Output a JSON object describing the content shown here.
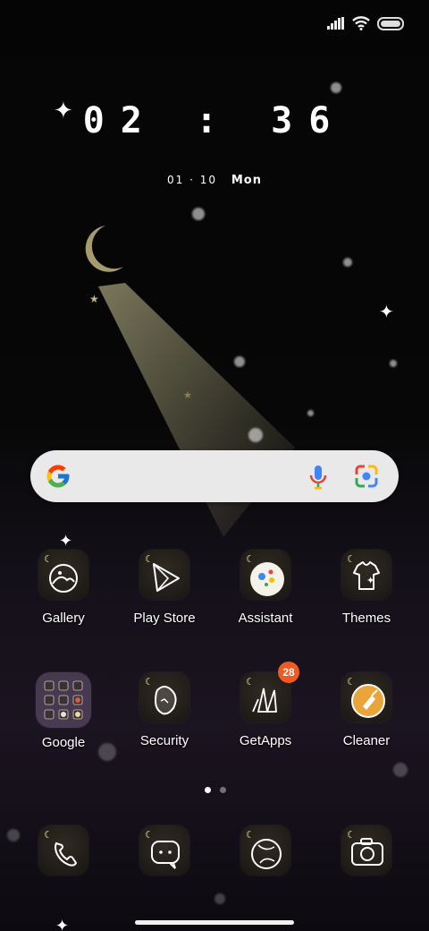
{
  "status_bar": {
    "signal_icon": "signal-bars-icon",
    "wifi_icon": "wifi-icon",
    "battery_icon": "battery-icon"
  },
  "clock": {
    "time": "02 : 36",
    "date": "01 · 10",
    "day": "Mon"
  },
  "search_bar": {
    "logo_icon": "google-g-icon",
    "mic_icon": "microphone-icon",
    "lens_icon": "google-lens-icon"
  },
  "apps": {
    "row1": [
      {
        "label": "Gallery",
        "icon": "gallery-icon"
      },
      {
        "label": "Play Store",
        "icon": "play-store-icon"
      },
      {
        "label": "Assistant",
        "icon": "assistant-icon"
      },
      {
        "label": "Themes",
        "icon": "themes-icon"
      }
    ],
    "row2": [
      {
        "label": "Google",
        "icon": "google-folder-icon"
      },
      {
        "label": "Security",
        "icon": "security-icon"
      },
      {
        "label": "GetApps",
        "icon": "getapps-icon",
        "badge": "28"
      },
      {
        "label": "Cleaner",
        "icon": "cleaner-icon"
      }
    ]
  },
  "dock": [
    {
      "icon": "phone-icon"
    },
    {
      "icon": "messages-icon"
    },
    {
      "icon": "browser-icon"
    },
    {
      "icon": "camera-icon"
    }
  ],
  "pager": {
    "pages": 2,
    "current": 1
  },
  "colors": {
    "accent_gold": "#f3e6a7",
    "badge": "#ee5a22",
    "search_bg": "#e9e9ea"
  }
}
